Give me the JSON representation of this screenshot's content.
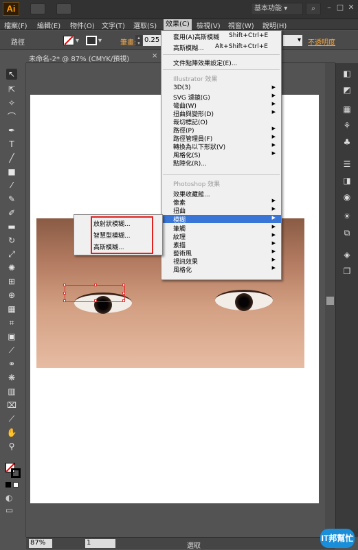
{
  "app": {
    "logo": "Ai",
    "workspace": "基本功能",
    "workspace_arrow": "▾",
    "search_icon": "⌕"
  },
  "window": {
    "minimize": "–",
    "maximize": "□",
    "close": "✕"
  },
  "menubar": [
    "檔案(F)",
    "編輯(E)",
    "物件(O)",
    "文字(T)",
    "選取(S)",
    "效果(C)",
    "檢視(V)",
    "視窗(W)",
    "說明(H)"
  ],
  "control": {
    "object_type": "路徑",
    "stroke_label": "筆畫:",
    "stroke_value": "0.25",
    "opacity_label": "不透明度"
  },
  "document": {
    "tab": "未命名-2* @ 87% (CMYK/預視)",
    "close": "×"
  },
  "status": {
    "zoom": "87%",
    "page": "1",
    "tool": "選取"
  },
  "effect_menu": {
    "top_items": [
      {
        "label": "套用(A)高斯模糊",
        "shortcut": "Shift+Ctrl+E"
      },
      {
        "label": "高斯模糊...",
        "shortcut": "Alt+Shift+Ctrl+E"
      }
    ],
    "doc_settings": "文件點陣效果設定(E)...",
    "illustrator_group": "Illustrator 效果",
    "illustrator_items": [
      {
        "label": "3D(3)",
        "sub": true
      },
      {
        "label": "SVG 濾鏡(G)",
        "sub": true
      },
      {
        "label": "彎曲(W)",
        "sub": true
      },
      {
        "label": "扭曲與變形(D)",
        "sub": true
      },
      {
        "label": "裁切標記(O)",
        "sub": false
      },
      {
        "label": "路徑(P)",
        "sub": true
      },
      {
        "label": "路徑管理員(F)",
        "sub": true
      },
      {
        "label": "轉換為以下形狀(V)",
        "sub": true
      },
      {
        "label": "風格化(S)",
        "sub": true
      },
      {
        "label": "點陣化(R)...",
        "sub": false
      }
    ],
    "photoshop_group": "Photoshop 效果",
    "photoshop_items": [
      {
        "label": "效果收藏館...",
        "sub": false
      },
      {
        "label": "像素",
        "sub": true
      },
      {
        "label": "扭曲",
        "sub": true
      },
      {
        "label": "模糊",
        "sub": true,
        "highlighted": true
      },
      {
        "label": "筆觸",
        "sub": true
      },
      {
        "label": "紋理",
        "sub": true
      },
      {
        "label": "素描",
        "sub": true
      },
      {
        "label": "藝術風",
        "sub": true
      },
      {
        "label": "視訊效果",
        "sub": true
      },
      {
        "label": "風格化",
        "sub": true
      }
    ]
  },
  "blur_submenu": [
    "放射狀模糊...",
    "智慧型模糊...",
    "高斯模糊..."
  ],
  "badge": "IT邦幫忙",
  "highlight_color": "#3875d7",
  "annotation_color": "#e12020",
  "tools": [
    "selection-tool-icon",
    "direct-selection-icon",
    "magic-wand-icon",
    "lasso-icon",
    "pen-icon",
    "type-icon",
    "line-icon",
    "rectangle-icon",
    "paintbrush-icon",
    "pencil-icon",
    "blob-brush-icon",
    "eraser-icon",
    "rotate-icon",
    "scale-icon",
    "warp-icon",
    "free-transform-icon",
    "shape-builder-icon",
    "perspective-icon",
    "mesh-icon",
    "gradient-icon",
    "eyedropper-icon",
    "blend-icon",
    "symbol-sprayer-icon",
    "graph-icon",
    "artboard-icon",
    "slice-icon",
    "hand-icon",
    "zoom-icon"
  ],
  "right_panels": [
    "color-icon",
    "color-guide-icon",
    "swatches-icon",
    "brushes-icon",
    "symbols-icon",
    "stroke-icon",
    "gradient-panel-icon",
    "transparency-icon",
    "appearance-icon",
    "graphic-styles-icon",
    "layers-icon",
    "artboards-icon"
  ]
}
